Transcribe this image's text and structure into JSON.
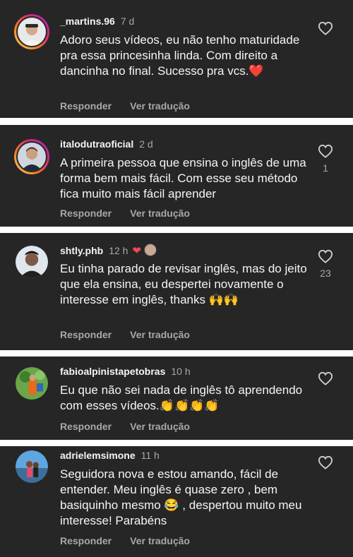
{
  "comments": [
    {
      "username": "_martins.96",
      "time": "7 d",
      "text": "Adoro seus vídeos, eu não tenho maturidade pra essa princesinha linda. Com direito a dancinha no final. Sucesso pra vcs.❤️",
      "reply": "Responder",
      "translate": "Ver tradução",
      "likes": ""
    },
    {
      "username": "italodutraoficial",
      "time": "2 d",
      "text": "A primeira pessoa que ensina o inglês de uma forma bem mais fácil. Com esse seu método fica muito mais fácil aprender",
      "reply": "Responder",
      "translate": "Ver tradução",
      "likes": "1"
    },
    {
      "username": "shtly.phb",
      "time": "12 h",
      "text": "Eu tinha parado de revisar inglês, mas do jeito que ela ensina, eu despertei novamente o interesse em inglês, thanks 🙌🙌",
      "reply": "Responder",
      "translate": "Ver tradução",
      "likes": "23",
      "creator_heart": "❤"
    },
    {
      "username": "fabioalpinistapetobras",
      "time": "10 h",
      "text": "Eu que não sei nada de inglês tô aprendendo com esses vídeos.👏👏👏👏",
      "reply": "Responder",
      "translate": "Ver tradução",
      "likes": ""
    },
    {
      "username": "adrielemsimone",
      "time": "11 h",
      "text": "Seguidora nova e estou amando, fácil de entender. Meu inglês é quase zero , bem basiquinho mesmo 😂 , despertou muito meu interesse! Parabéns",
      "reply": "Responder",
      "translate": "Ver tradução",
      "likes": ""
    }
  ],
  "icons": {
    "like": "heart-outline-icon",
    "creator_like": "heart-filled-icon"
  },
  "colors": {
    "background": "#262626",
    "separator": "#ffffff",
    "secondary_text": "#a8a8a8",
    "creator_heart": "#ed4956"
  }
}
